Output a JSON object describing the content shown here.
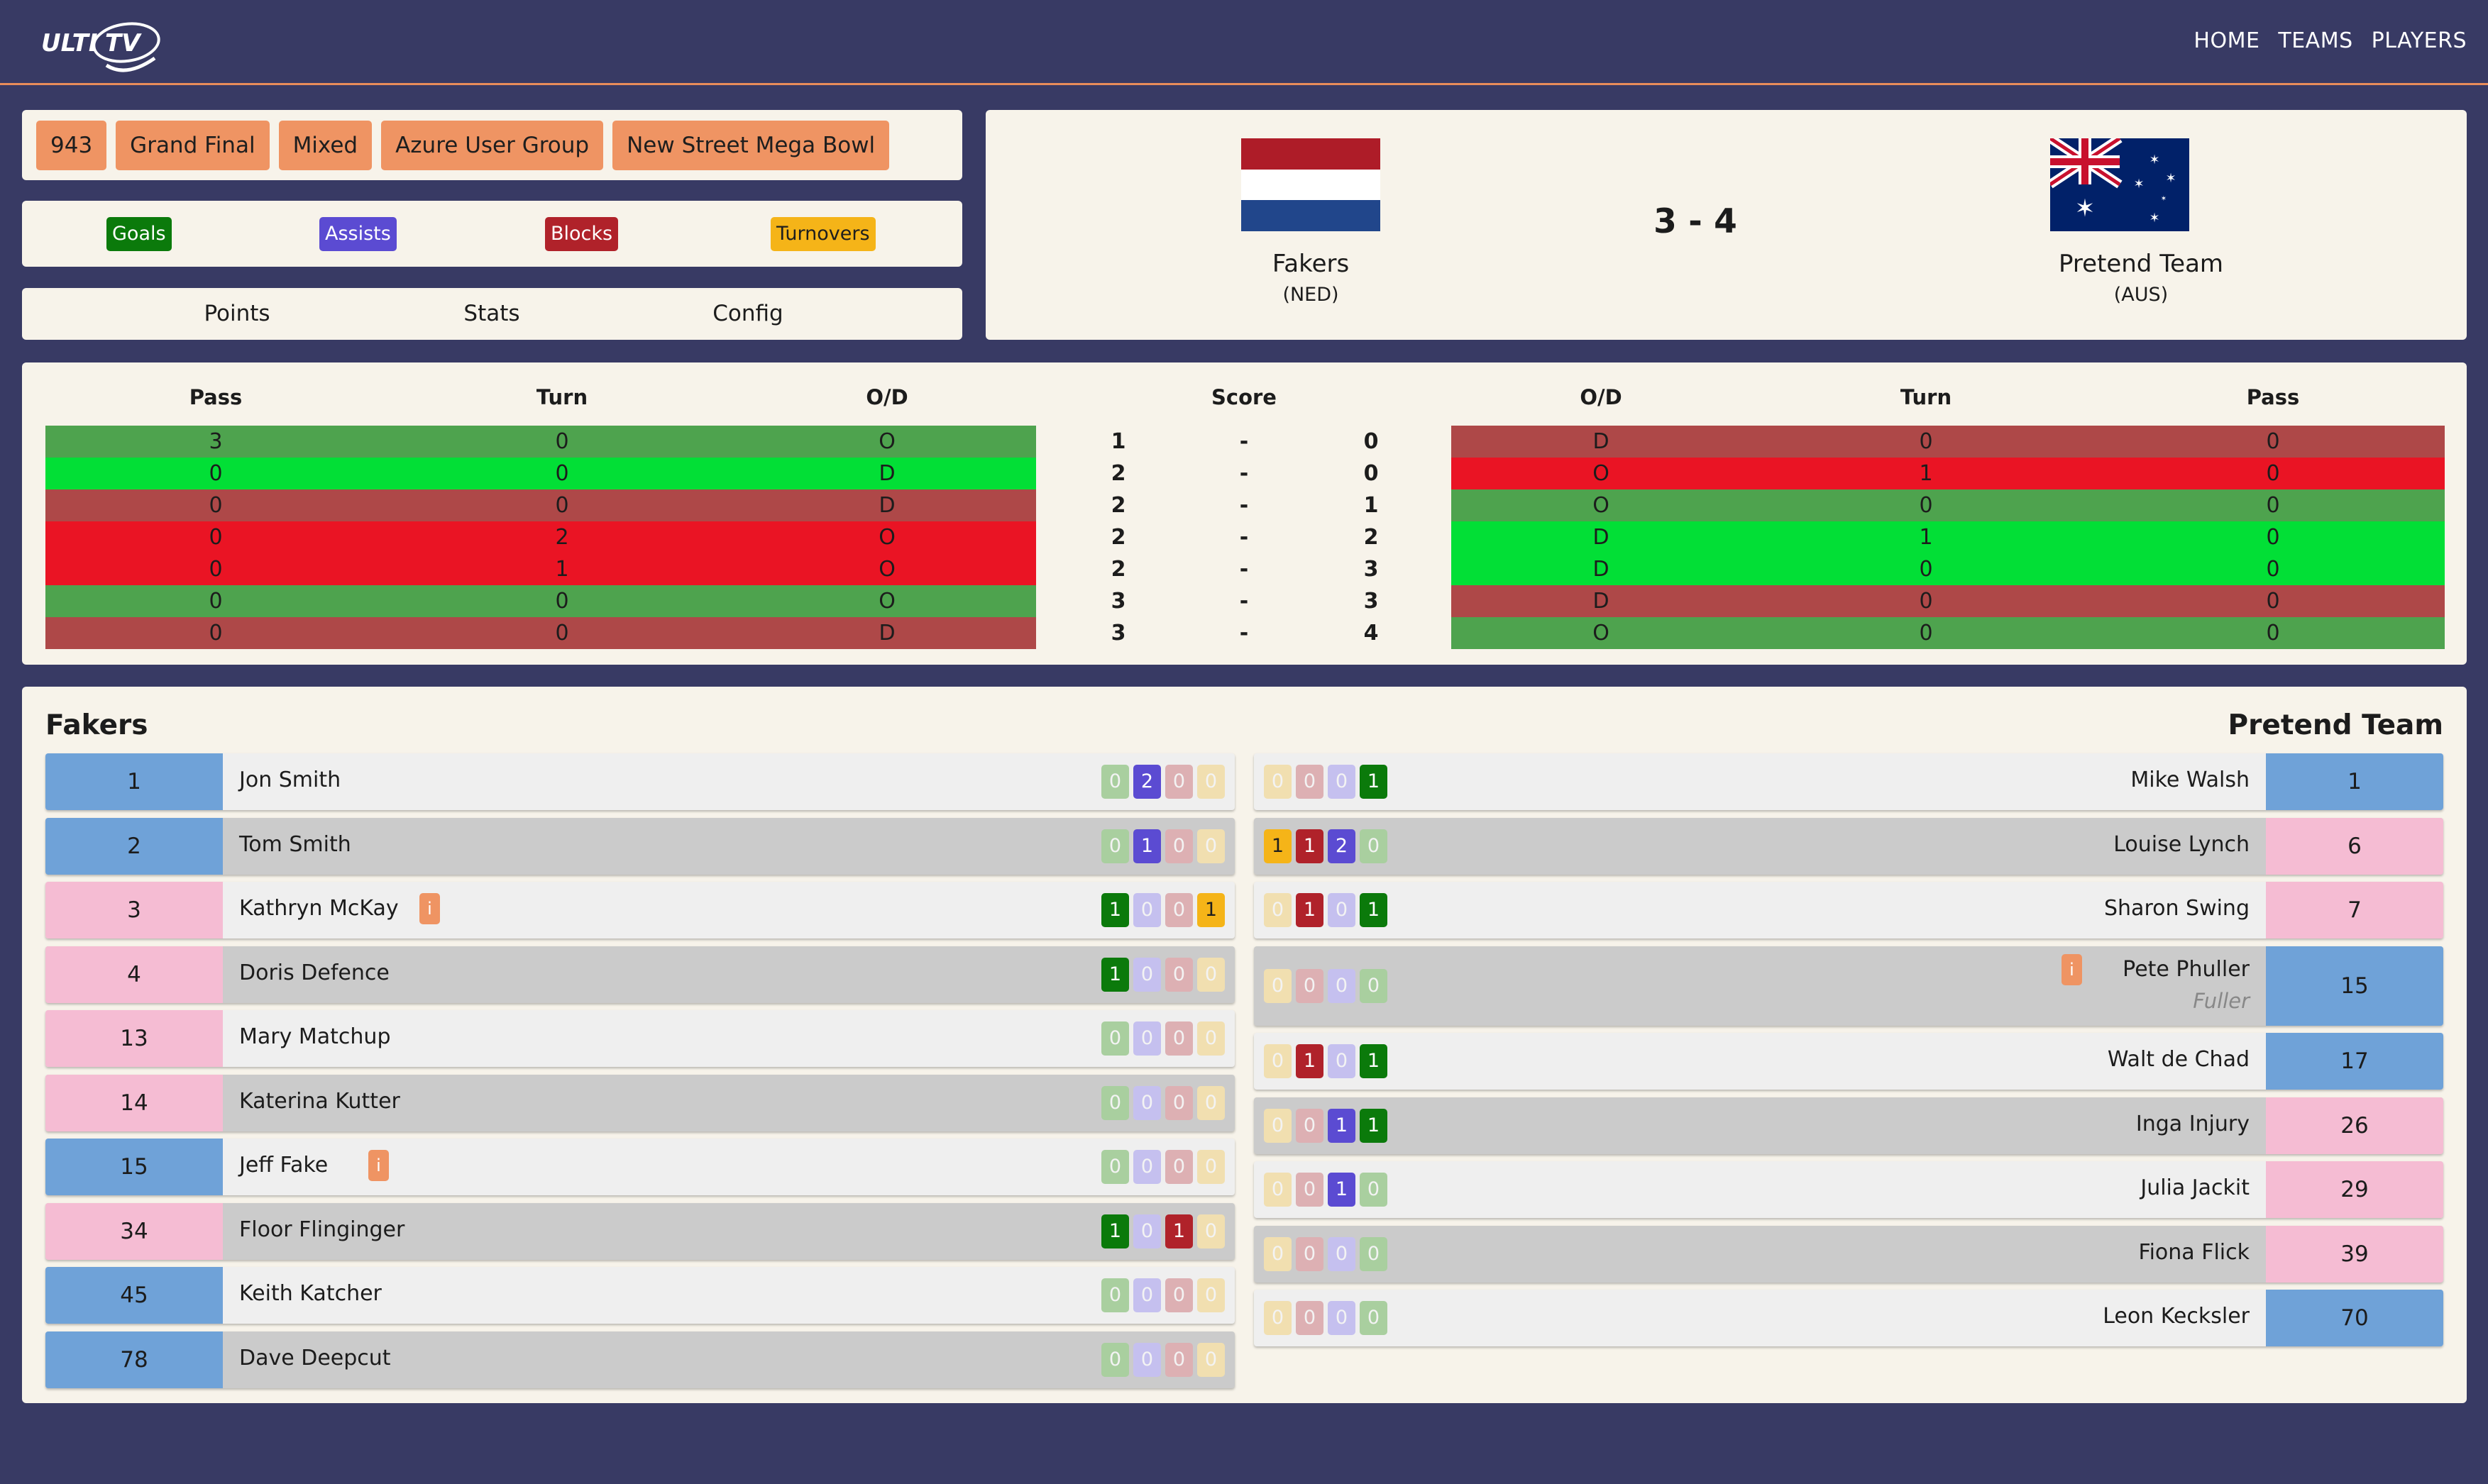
{
  "header": {
    "logo_text": "ULTI TV",
    "nav": [
      "HOME",
      "TEAMS",
      "PLAYERS"
    ]
  },
  "tags": [
    "943",
    "Grand Final",
    "Mixed",
    "Azure User Group",
    "New Street Mega Bowl"
  ],
  "legend": [
    {
      "label": "Goals",
      "color": "#0b7a0b",
      "text": "#ffffff"
    },
    {
      "label": "Assists",
      "color": "#5b4bd2",
      "text": "#ffffff"
    },
    {
      "label": "Blocks",
      "color": "#b0222a",
      "text": "#ffffff"
    },
    {
      "label": "Turnovers",
      "color": "#f5b418",
      "text": "#1e1e1e"
    }
  ],
  "tabs": [
    "Points",
    "Stats",
    "Config"
  ],
  "match": {
    "home": {
      "name": "Fakers",
      "code": "(NED)"
    },
    "away": {
      "name": "Pretend Team",
      "code": "(AUS)"
    },
    "score": "3 - 4"
  },
  "points": {
    "headers_left": [
      "Pass",
      "Turn",
      "O/D"
    ],
    "header_score": "Score",
    "headers_right": [
      "O/D",
      "Turn",
      "Pass"
    ],
    "rows": [
      {
        "lpass": "3",
        "lturn": "0",
        "lod": "O",
        "ls": "1",
        "sep": "-",
        "rs": "0",
        "rod": "D",
        "rturn": "0",
        "rpass": "0",
        "lcol": "#4ea34e",
        "rcol": "#ae4848"
      },
      {
        "lpass": "0",
        "lturn": "0",
        "lod": "D",
        "ls": "2",
        "sep": "-",
        "rs": "0",
        "rod": "O",
        "rturn": "1",
        "rpass": "0",
        "lcol": "#02df36",
        "rcol": "#ea1424"
      },
      {
        "lpass": "0",
        "lturn": "0",
        "lod": "D",
        "ls": "2",
        "sep": "-",
        "rs": "1",
        "rod": "O",
        "rturn": "0",
        "rpass": "0",
        "lcol": "#ae4848",
        "rcol": "#4ea34e"
      },
      {
        "lpass": "0",
        "lturn": "2",
        "lod": "O",
        "ls": "2",
        "sep": "-",
        "rs": "2",
        "rod": "D",
        "rturn": "1",
        "rpass": "0",
        "lcol": "#ea1424",
        "rcol": "#02df36"
      },
      {
        "lpass": "0",
        "lturn": "1",
        "lod": "O",
        "ls": "2",
        "sep": "-",
        "rs": "3",
        "rod": "D",
        "rturn": "0",
        "rpass": "0",
        "lcol": "#ea1424",
        "rcol": "#02df36"
      },
      {
        "lpass": "0",
        "lturn": "0",
        "lod": "O",
        "ls": "3",
        "sep": "-",
        "rs": "3",
        "rod": "D",
        "rturn": "0",
        "rpass": "0",
        "lcol": "#4ea34e",
        "rcol": "#ae4848"
      },
      {
        "lpass": "0",
        "lturn": "0",
        "lod": "D",
        "ls": "3",
        "sep": "-",
        "rs": "4",
        "rod": "O",
        "rturn": "0",
        "rpass": "0",
        "lcol": "#ae4848",
        "rcol": "#4ea34e"
      }
    ]
  },
  "roster": {
    "home_title": "Fakers",
    "away_title": "Pretend Team",
    "home": [
      {
        "num": "1",
        "name": "Jon Smith",
        "g": "0",
        "a": "2",
        "b": "0",
        "t": "0",
        "gender": "m",
        "info": false
      },
      {
        "num": "2",
        "name": "Tom Smith",
        "g": "0",
        "a": "1",
        "b": "0",
        "t": "0",
        "gender": "m",
        "info": false
      },
      {
        "num": "3",
        "name": "Kathryn McKay",
        "g": "1",
        "a": "0",
        "b": "0",
        "t": "1",
        "gender": "f",
        "info": true
      },
      {
        "num": "4",
        "name": "Doris Defence",
        "g": "1",
        "a": "0",
        "b": "0",
        "t": "0",
        "gender": "f",
        "info": false
      },
      {
        "num": "13",
        "name": "Mary Matchup",
        "g": "0",
        "a": "0",
        "b": "0",
        "t": "0",
        "gender": "f",
        "info": false
      },
      {
        "num": "14",
        "name": "Katerina Kutter",
        "g": "0",
        "a": "0",
        "b": "0",
        "t": "0",
        "gender": "f",
        "info": false
      },
      {
        "num": "15",
        "name": "Jeff Fake",
        "g": "0",
        "a": "0",
        "b": "0",
        "t": "0",
        "gender": "m",
        "info": true
      },
      {
        "num": "34",
        "name": "Floor Flinginger",
        "g": "1",
        "a": "0",
        "b": "1",
        "t": "0",
        "gender": "f",
        "info": false
      },
      {
        "num": "45",
        "name": "Keith Katcher",
        "g": "0",
        "a": "0",
        "b": "0",
        "t": "0",
        "gender": "m",
        "info": false
      },
      {
        "num": "78",
        "name": "Dave Deepcut",
        "g": "0",
        "a": "0",
        "b": "0",
        "t": "0",
        "gender": "m",
        "info": false
      }
    ],
    "away": [
      {
        "num": "1",
        "name": "Mike Walsh",
        "g": "1",
        "a": "0",
        "b": "0",
        "t": "0",
        "gender": "m",
        "info": false,
        "sub": ""
      },
      {
        "num": "6",
        "name": "Louise Lynch",
        "g": "0",
        "a": "2",
        "b": "1",
        "t": "1",
        "gender": "f",
        "info": false,
        "sub": ""
      },
      {
        "num": "7",
        "name": "Sharon Swing",
        "g": "1",
        "a": "0",
        "b": "1",
        "t": "0",
        "gender": "f",
        "info": false,
        "sub": ""
      },
      {
        "num": "15",
        "name": "Pete Phuller",
        "g": "0",
        "a": "0",
        "b": "0",
        "t": "0",
        "gender": "m",
        "info": true,
        "sub": "Fuller"
      },
      {
        "num": "17",
        "name": "Walt de Chad",
        "g": "1",
        "a": "0",
        "b": "1",
        "t": "0",
        "gender": "m",
        "info": false,
        "sub": ""
      },
      {
        "num": "26",
        "name": "Inga Injury",
        "g": "1",
        "a": "1",
        "b": "0",
        "t": "0",
        "gender": "f",
        "info": false,
        "sub": ""
      },
      {
        "num": "29",
        "name": "Julia Jackit",
        "g": "0",
        "a": "1",
        "b": "0",
        "t": "0",
        "gender": "f",
        "info": false,
        "sub": ""
      },
      {
        "num": "39",
        "name": "Fiona Flick",
        "g": "0",
        "a": "0",
        "b": "0",
        "t": "0",
        "gender": "f",
        "info": false,
        "sub": ""
      },
      {
        "num": "70",
        "name": "Leon Kecksler",
        "g": "0",
        "a": "0",
        "b": "0",
        "t": "0",
        "gender": "m",
        "info": false,
        "sub": ""
      }
    ],
    "info_glyph": "i"
  },
  "colors": {
    "background": "#383a64",
    "panel": "#f7f3ea",
    "accent": "#ef9463",
    "male": "#6fa2d8",
    "female": "#f5bcd3",
    "row_light": "#efefef",
    "row_dark": "#cbcbcb"
  }
}
